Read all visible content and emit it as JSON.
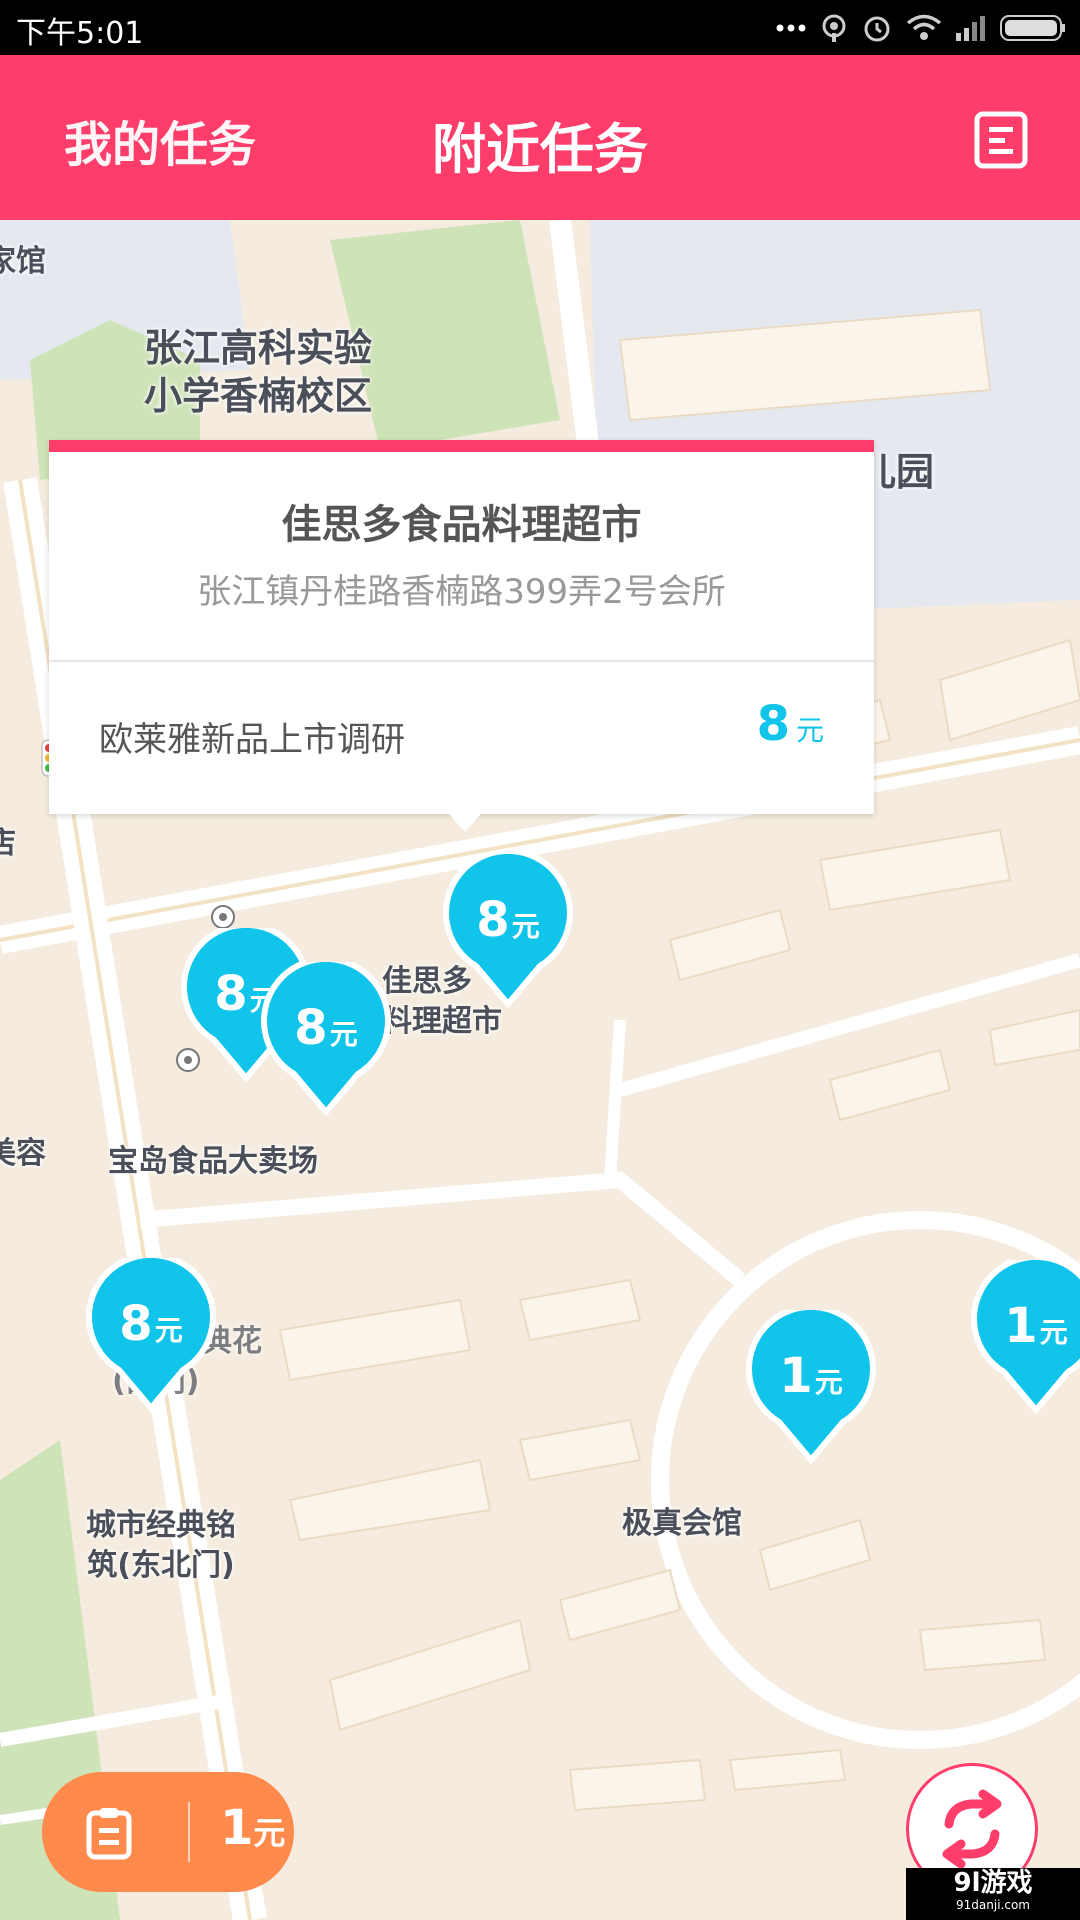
{
  "status_bar": {
    "time": "下午5:01"
  },
  "header": {
    "tab_mine": "我的任务",
    "tab_nearby": "附近任务",
    "list_icon": "document-list-icon",
    "accent_color": "#ff3d6b"
  },
  "map": {
    "labels": {
      "school": "张江高科实验\n小学香楠校区",
      "kindergarten": "儿园",
      "guan": "家馆",
      "dian": "店",
      "store": "佳思多\n料理超市",
      "baodao": "宝岛食品大卖场",
      "meirong": "美容",
      "chengshi_hua": "城市经典花\n(西门)",
      "chengshi_ming": "城市经典铭\n筑(东北门)",
      "jizhen": "极真会馆"
    },
    "pins": [
      {
        "amount": "8",
        "unit": "元"
      },
      {
        "amount": "8",
        "unit": "元"
      },
      {
        "amount": "8",
        "unit": "元"
      },
      {
        "amount": "8",
        "unit": "元"
      },
      {
        "amount": "1",
        "unit": "元"
      },
      {
        "amount": "1",
        "unit": "元"
      }
    ],
    "pin_color": "#11c4ea"
  },
  "popup": {
    "store_name": "佳思多食品料理超市",
    "address": "张江镇丹桂路香楠路399弄2号会所",
    "task_name": "欧莱雅新品上市调研",
    "price": "8",
    "unit": "元"
  },
  "bottom": {
    "amount": "1",
    "unit": "元",
    "badge_color": "#ff8a4c",
    "icon": "clipboard-icon",
    "refresh_icon": "refresh-icon"
  },
  "watermark": {
    "brand": "9l游戏",
    "site": "91danji.com"
  }
}
